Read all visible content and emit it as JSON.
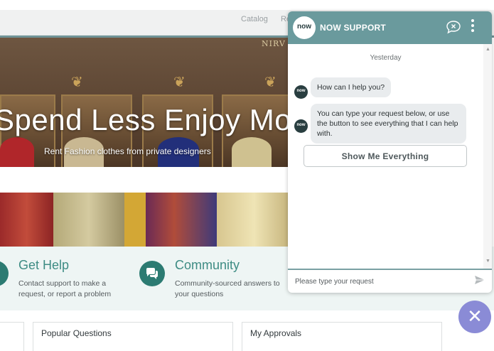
{
  "nav": {
    "catalog": "Catalog",
    "partial_link": "Re"
  },
  "hero": {
    "title": "Spend Less Enjoy More",
    "subtitle": "Rent Fashion clothes from private designers",
    "sign": "NIRV"
  },
  "help": {
    "get_help": {
      "title": "Get Help",
      "desc": "Contact support to make a request, or report a problem"
    },
    "community": {
      "title": "Community",
      "desc": "Community-sourced answers to your questions"
    }
  },
  "cards": {
    "popular": "Popular Questions",
    "approvals": "My Approvals"
  },
  "chat": {
    "logo_text": "now",
    "title": "NOW SUPPORT",
    "date": "Yesterday",
    "messages": [
      "How can I help you?",
      "You can type your request below, or use the button to see everything that I can help with."
    ],
    "show_button": "Show Me Everything",
    "input_placeholder": "Please type your request",
    "close_symbol": "✕"
  },
  "colors": {
    "accent": "#6a9a9d",
    "teal_dark": "#2c7b72",
    "fab": "#8a8bd6"
  },
  "icons": [
    "end-chat-icon",
    "more-vertical-icon",
    "send-icon",
    "close-icon",
    "chat-bubbles-icon"
  ]
}
